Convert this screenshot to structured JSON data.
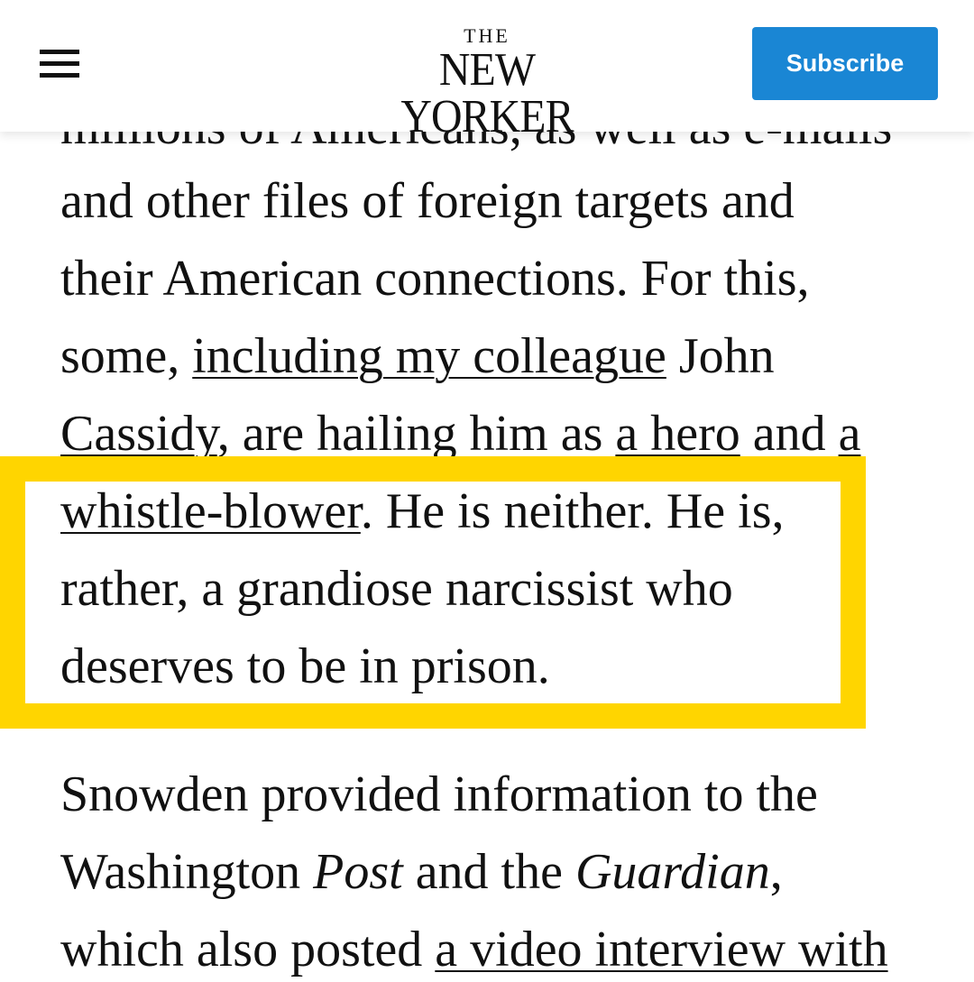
{
  "header": {
    "logo_the": "THE",
    "logo_name": "NEW YORKER",
    "subscribe_label": "Subscribe",
    "brand_color": "#1a86d4"
  },
  "highlight_color": "#ffd500",
  "article": {
    "line_cutoff": "millions of Americans, as well as e-mails",
    "line1": "and other files of foreign targets and",
    "line2": "their American connections. For this,",
    "line3": {
      "pre": "some, ",
      "link": "including my colleague",
      "post": " John"
    },
    "line4": {
      "link1": "Cassidy",
      "mid": ", are hailing him as ",
      "link2": "a hero",
      "mid2": " and ",
      "link3": "a"
    },
    "line5": {
      "link": "whistle-blower",
      "post": ". He is neither. He is,"
    },
    "line6": "rather, a grandiose narcissist who",
    "line7": "deserves to be in prison.",
    "line8": "Snowden provided information to the",
    "line9": {
      "pre": "Washington ",
      "italic1": "Post",
      "mid": " and the ",
      "italic2": "Guardian",
      "post": ","
    },
    "line10": {
      "pre": "which also posted ",
      "link": "a video interview with"
    }
  }
}
